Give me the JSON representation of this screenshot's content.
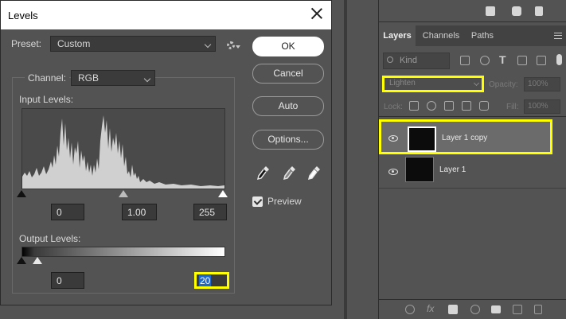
{
  "dialog": {
    "title": "Levels",
    "preset_label": "Preset:",
    "preset_value": "Custom",
    "channel_label": "Channel:",
    "channel_value": "RGB",
    "input_levels_label": "Input Levels:",
    "input_black": "0",
    "input_gamma": "1.00",
    "input_white": "255",
    "output_levels_label": "Output Levels:",
    "output_black": "0",
    "output_white": "20",
    "buttons": {
      "ok": "OK",
      "cancel": "Cancel",
      "auto": "Auto",
      "options": "Options..."
    },
    "preview_label": "Preview",
    "preview_checked": true
  },
  "layers_panel": {
    "tabs": [
      "Layers",
      "Channels",
      "Paths"
    ],
    "active_tab": "Layers",
    "kind_filter": "Kind",
    "blend_mode": "Lighten",
    "opacity_label": "Opacity:",
    "opacity_value": "100%",
    "lock_label": "Lock:",
    "fill_label": "Fill:",
    "fill_value": "100%",
    "layers": [
      {
        "name": "Layer 1 copy",
        "selected": true,
        "visible": true
      },
      {
        "name": "Layer 1",
        "selected": false,
        "visible": true
      }
    ]
  },
  "icons": {
    "top_strip": [
      "new-group-icon",
      "camera-icon",
      "trash-icon"
    ],
    "filters": [
      "image-filter-icon",
      "adjustment-filter-icon",
      "type-filter-icon",
      "shape-filter-icon",
      "smart-object-filter-icon"
    ],
    "locks": [
      "lock-transparent-icon",
      "lock-image-icon",
      "lock-position-icon",
      "lock-artboard-icon",
      "lock-all-icon"
    ],
    "bottom_bar": [
      "link-icon",
      "fx-icon",
      "mask-icon",
      "adjustment-icon",
      "folder-icon",
      "new-layer-icon",
      "trash-icon"
    ]
  },
  "colors": {
    "highlight": "#ffff00",
    "selection_text": "#1d68c8",
    "panel_bg": "#535353"
  }
}
